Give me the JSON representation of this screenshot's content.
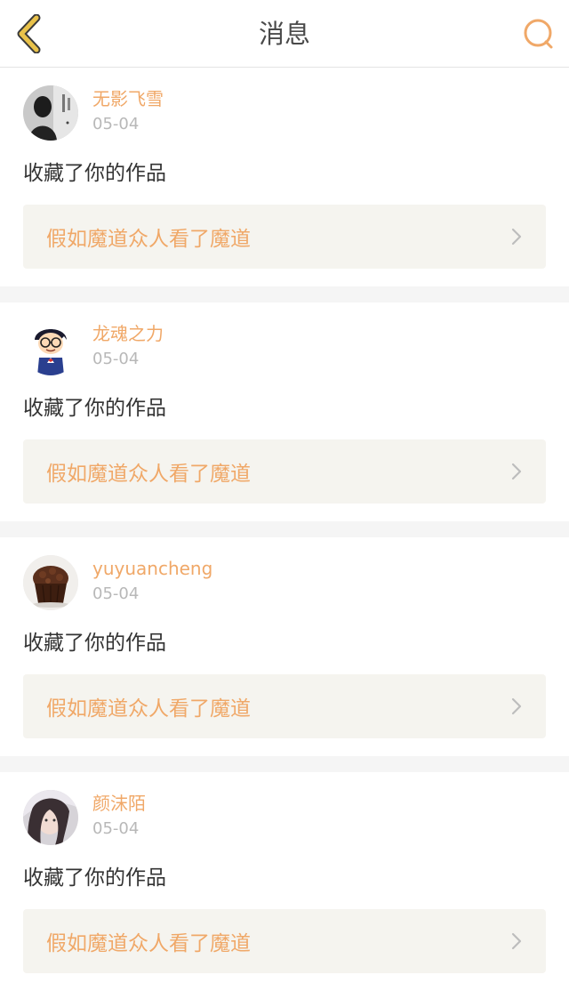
{
  "header": {
    "title": "消息",
    "back_icon": "chevron-left-icon",
    "search_icon": "search-icon",
    "accent_color": "#f0a868",
    "back_color": "#e9c24a"
  },
  "messages": [
    {
      "username": "无影飞雪",
      "date": "05-04",
      "action": "收藏了你的作品",
      "work_title": "假如魔道众人看了魔道",
      "avatar_icon": "avatar-photo-icon"
    },
    {
      "username": "龙魂之力",
      "date": "05-04",
      "action": "收藏了你的作品",
      "work_title": "假如魔道众人看了魔道",
      "avatar_icon": "avatar-cartoon-icon"
    },
    {
      "username": "yuyuancheng",
      "date": "05-04",
      "action": "收藏了你的作品",
      "work_title": "假如魔道众人看了魔道",
      "avatar_icon": "avatar-cupcake-icon"
    },
    {
      "username": "颜沫陌",
      "date": "05-04",
      "action": "收藏了你的作品",
      "work_title": "假如魔道众人看了魔道",
      "avatar_icon": "avatar-photo-icon"
    }
  ]
}
